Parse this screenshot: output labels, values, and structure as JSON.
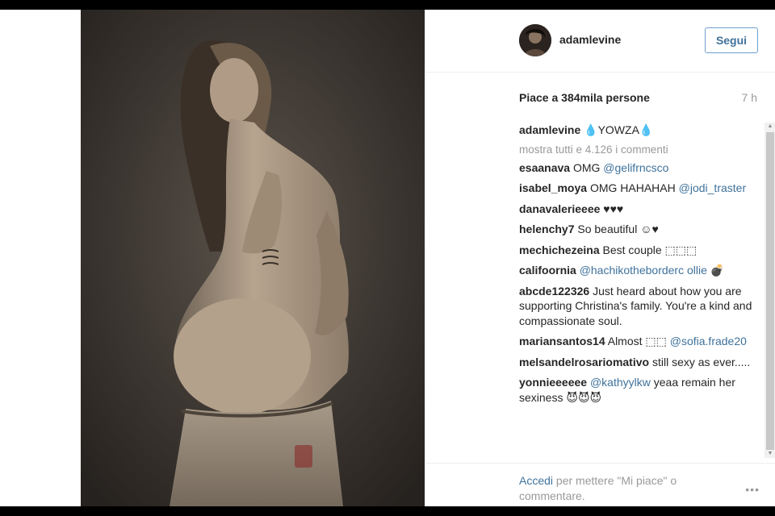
{
  "post": {
    "username": "adamlevine",
    "follow_label": "Segui",
    "likes_text": "Piace a 384mila persone",
    "time_ago": "7 h"
  },
  "comments": {
    "view_all": "mostra tutti e 4.126 i commenti",
    "caption": {
      "user": "adamlevine",
      "text": " 💧YOWZA💧"
    },
    "items": [
      {
        "user": "esaanava",
        "text": " OMG ",
        "mention": "@gelifrncsco",
        "tail": ""
      },
      {
        "user": "isabel_moya",
        "text": " OMG HAHAHAH ",
        "mention": "@jodi_traster",
        "tail": ""
      },
      {
        "user": "danavalerieeee",
        "text": " ♥♥♥",
        "mention": "",
        "tail": ""
      },
      {
        "user": "helenchy7",
        "text": " So beautiful ☺♥",
        "mention": "",
        "tail": ""
      },
      {
        "user": "mechichezeina",
        "text": " Best couple ⬚⬚⬚",
        "mention": "",
        "tail": ""
      },
      {
        "user": "califoornia",
        "text": " ",
        "mention": "@hachikotheborderc ollie",
        "tail": " 💣"
      },
      {
        "user": "abcde122326",
        "text": " Just heard about how you are supporting Christina's family. You're a kind and compassionate soul.",
        "mention": "",
        "tail": ""
      },
      {
        "user": "mariansantos14",
        "text": " Almost ⬚⬚ ",
        "mention": "@sofia.frade20",
        "tail": ""
      },
      {
        "user": "melsandelrosariomativo",
        "text": " still sexy as ever.....",
        "mention": "",
        "tail": ""
      },
      {
        "user": "yonnieeeeee",
        "text": " ",
        "mention": "@kathyylkw",
        "tail": " yeaa remain her sexiness 😈😈😈"
      }
    ]
  },
  "footer": {
    "login_link": "Accedi",
    "login_rest": " per mettere \"Mi piace\" o commentare.",
    "more": "•••"
  },
  "icons": {
    "more": "ellipsis-icon",
    "scroll_up": "arrow-up-icon",
    "scroll_down": "arrow-down-icon"
  }
}
